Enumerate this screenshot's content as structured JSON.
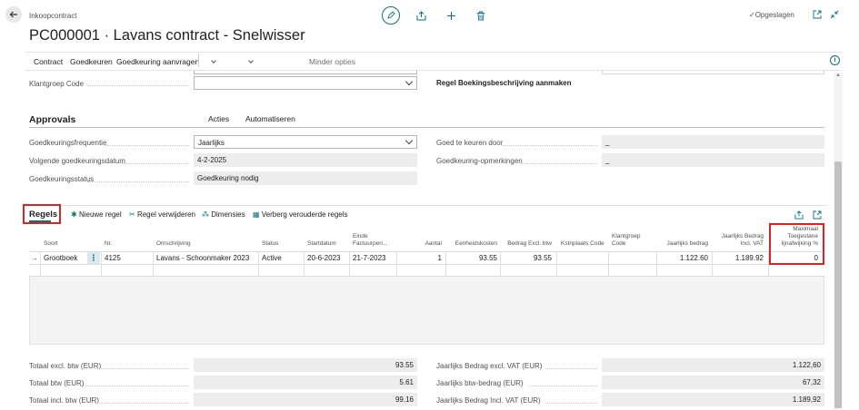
{
  "header": {
    "breadcrumb": "Inkoopcontract",
    "title": "PC000001 · Lavans contract - Snelwisser",
    "saved_status": "Opgeslagen"
  },
  "actionbar": {
    "items": [
      "Contract",
      "Goedkeuren",
      "Goedkeuring aanvragen",
      "Acties",
      "Automatiseren",
      "Minder opties"
    ]
  },
  "general": {
    "klantgroep_label": "Klantgroep Code",
    "klantgroep_value": "",
    "regel_boeking_label": "Regel Boekingsbeschrijving aanmaken"
  },
  "approvals": {
    "heading": "Approvals",
    "freq_label": "Goedkeuringsfrequentie",
    "freq_value": "Jaarlijks",
    "next_date_label": "Volgende goedkeuringsdatum",
    "next_date_value": "4-2-2025",
    "status_label": "Goedkeuringsstatus",
    "status_value": "Goedkeuring nodig",
    "approver_label": "Goed te keuren door",
    "approver_value": "_",
    "remarks_label": "Goedkeuring-opmerkingen",
    "remarks_value": "_"
  },
  "lines": {
    "tab_label": "Regels",
    "actions": [
      "Nieuwe regel",
      "Regel verwijderen",
      "Dimensies",
      "Verberg verouderde regels"
    ],
    "columns": {
      "soort": "Soort",
      "nr": "Nr.",
      "omschrijving": "Omschrijving",
      "status": "Status",
      "startdatum": "Startdatum",
      "einde": "Einde Factuurperi...",
      "aantal": "Aantal",
      "eenheidskosten": "Eenheidskosten",
      "bedrag": "Bedrag Excl. btw",
      "kostenplaats": "Kstnplaats Code",
      "klantgroep": "Klantgroep Code",
      "jaarlijks": "Jaarlijks bedrag",
      "jaarlijks_incl": "Jaarlijks Bedrag Incl. VAT",
      "max_afwijking": "Maximaal Toegestane lijnafwijking %"
    },
    "row": {
      "soort": "Grootboek",
      "nr": "4125",
      "omschrijving": "Lavans - Schoonmaker 2023",
      "status": "Active",
      "startdatum": "20-6-2023",
      "einde": "21-7-2023",
      "aantal": "1",
      "eenheidskosten": "93.55",
      "bedrag": "93.55",
      "kostenplaats": "",
      "klantgroep": "",
      "jaarlijks": "1.122.60",
      "jaarlijks_incl": "1.189.92",
      "max_afwijking": "0"
    }
  },
  "totals": {
    "excl_label": "Totaal excl. btw (EUR)",
    "excl_value": "93.55",
    "btw_label": "Totaal btw (EUR)",
    "btw_value": "5.61",
    "incl_label": "Totaal incl. btw (EUR)",
    "incl_value": "99.16",
    "y_excl_label": "Jaarlijks Bedrag excl. VAT (EUR)",
    "y_excl_value": "1.122,60",
    "y_btw_label": "Jaarlijks btw-bedrag (EUR)",
    "y_btw_value": "67,32",
    "y_incl_label": "Jaarlijks Bedrag Incl. VAT (EUR)",
    "y_incl_value": "1.189,92"
  },
  "colors": {
    "accent": "#0f6f7e",
    "highlight": "#d92424"
  }
}
